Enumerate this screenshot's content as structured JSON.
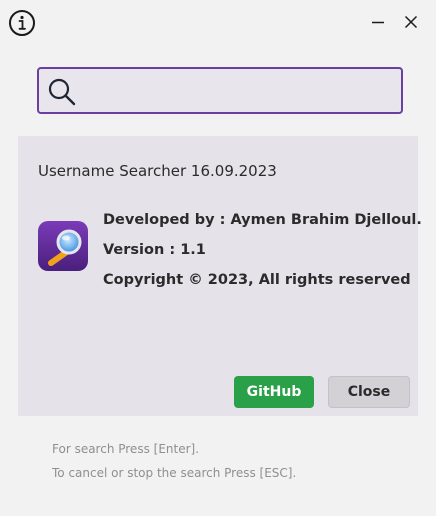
{
  "titlebar": {
    "info_icon": "info-icon",
    "minimize_icon": "minimize-icon",
    "close_icon": "close-icon"
  },
  "search": {
    "icon": "search-icon",
    "value": "",
    "placeholder": "",
    "accent_color": "#6b3fa0"
  },
  "about": {
    "title": "Username Searcher 16.09.2023",
    "app_icon": "magnifier-app-icon",
    "developer": "Developed by : Aymen Brahim Djelloul.",
    "version": "Version : 1.1",
    "copyright": "Copyright © 2023, All rights reserved",
    "github_label": "GitHub",
    "close_label": "Close",
    "github_color": "#2aa048"
  },
  "hints": {
    "search": "For search Press [Enter].",
    "cancel": "To cancel or stop the search Press [ESC]."
  }
}
